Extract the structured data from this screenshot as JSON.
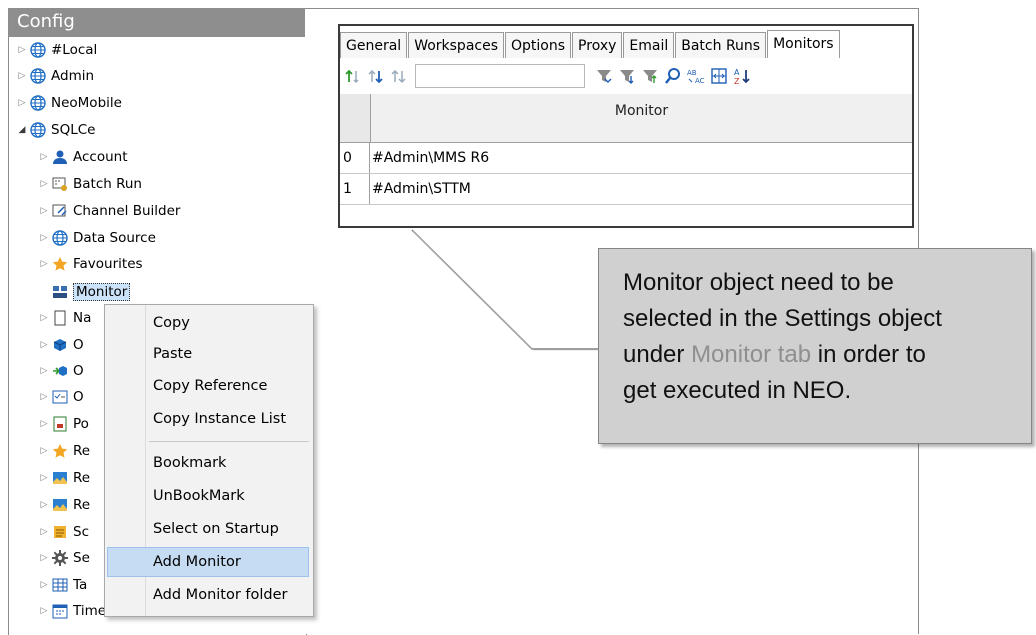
{
  "left_panel": {
    "title": "Config",
    "tree": [
      {
        "label": "#Local",
        "icon": "globe-icon",
        "state": "collapsed"
      },
      {
        "label": "Admin",
        "icon": "globe-icon",
        "state": "collapsed"
      },
      {
        "label": "NeoMobile",
        "icon": "globe-icon",
        "state": "collapsed"
      },
      {
        "label": "SQLCe",
        "icon": "globe-icon",
        "state": "expanded"
      },
      {
        "label": "Account",
        "icon": "user-icon",
        "state": "collapsed"
      },
      {
        "label": "Batch Run",
        "icon": "batch-run-icon",
        "state": "collapsed"
      },
      {
        "label": "Channel Builder",
        "icon": "channel-builder-icon",
        "state": "collapsed"
      },
      {
        "label": "Data Source",
        "icon": "globe-icon",
        "state": "collapsed"
      },
      {
        "label": "Favourites",
        "icon": "star-icon",
        "state": "collapsed"
      },
      {
        "label": "Monitor",
        "icon": "monitor-icon",
        "state": "selected"
      },
      {
        "label": "Na",
        "icon": "document-icon",
        "state": "collapsed"
      },
      {
        "label": "O",
        "icon": "cube-icon",
        "state": "collapsed"
      },
      {
        "label": "O",
        "icon": "arrow-cube-icon",
        "state": "collapsed"
      },
      {
        "label": "O",
        "icon": "form-icon",
        "state": "collapsed"
      },
      {
        "label": "Po",
        "icon": "report-icon",
        "state": "collapsed"
      },
      {
        "label": "Re",
        "icon": "star-icon",
        "state": "collapsed"
      },
      {
        "label": "Re",
        "icon": "image-icon",
        "state": "collapsed"
      },
      {
        "label": "Re",
        "icon": "image-icon",
        "state": "collapsed"
      },
      {
        "label": "Sc",
        "icon": "script-icon",
        "state": "collapsed"
      },
      {
        "label": "Se",
        "icon": "gear-icon",
        "state": "collapsed"
      },
      {
        "label": "Ta",
        "icon": "table-icon",
        "state": "collapsed"
      },
      {
        "label": "Time Slice",
        "icon": "calendar-icon",
        "state": "collapsed"
      }
    ]
  },
  "context_menu": {
    "items": [
      "Copy",
      "Paste",
      "Copy Reference",
      "Copy Instance List",
      "Bookmark",
      "UnBookMark",
      "Select on Startup",
      "Add Monitor",
      "Add Monitor folder"
    ],
    "highlighted": "Add Monitor"
  },
  "settings": {
    "tabs": [
      "General",
      "Workspaces",
      "Options",
      "Proxy",
      "Email",
      "Batch Runs",
      "Monitors"
    ],
    "active_tab": "Monitors",
    "search_value": "",
    "toolbar_icons": [
      "sort-up-icon",
      "sort-down-icon",
      "sort-both-icon",
      "filter-icon",
      "filter-down-icon",
      "filter-up-icon",
      "find-icon",
      "replace-icon",
      "fit-columns-icon",
      "sort-az-icon"
    ],
    "grid": {
      "column_header": "Monitor",
      "rows": [
        {
          "index": "0",
          "value": "#Admin\\MMS R6"
        },
        {
          "index": "1",
          "value": "#Admin\\STTM"
        }
      ]
    }
  },
  "callout": {
    "line1": "Monitor object need to be",
    "line2": "selected in the Settings object",
    "line3_before": "under ",
    "line3_highlight": "Monitor tab",
    "line3_after": " in order to",
    "line4": "get executed in NEO."
  },
  "colors": {
    "header_bg": "#8e8e8e",
    "selection": "#cbe3f9",
    "menu_highlight": "#c6dcf3",
    "callout_bg": "#d0d0d0",
    "callout_highlight_text": "#8f8f8f",
    "globe_blue": "#1f6fc5"
  }
}
